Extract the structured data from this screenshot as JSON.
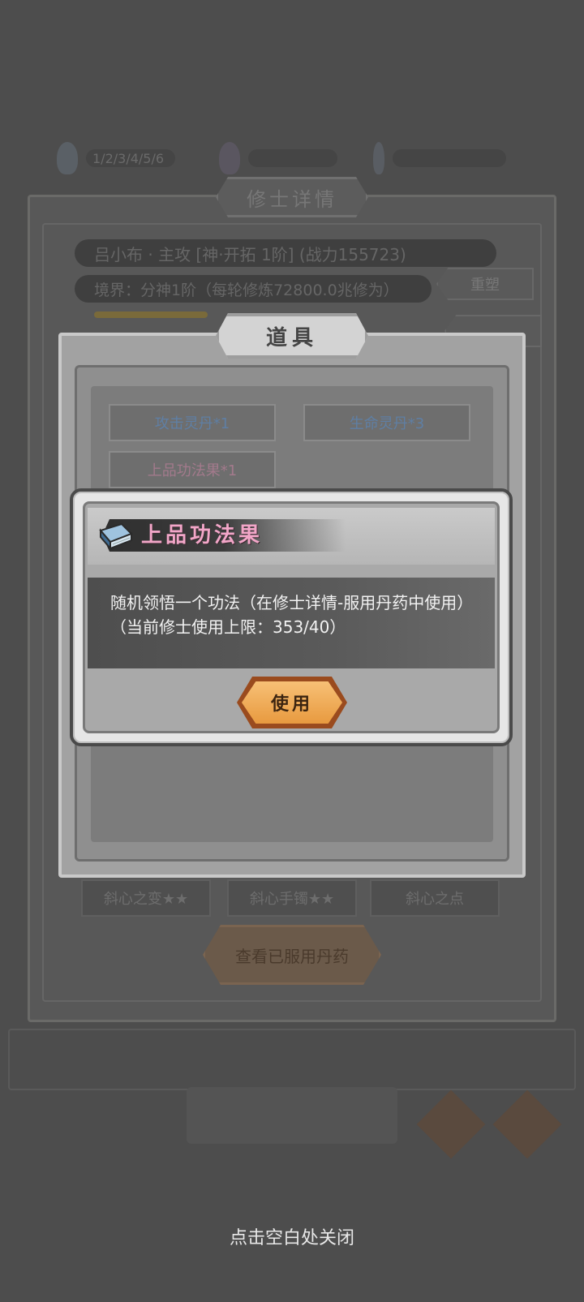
{
  "background": {
    "top_bar": [
      {
        "icon": "blue-orb-icon",
        "text": "1/2/3/4/5/6"
      },
      {
        "icon": "purple-orb-icon",
        "text": ""
      },
      {
        "icon": "feather-icon",
        "text": ""
      }
    ],
    "header_title": "修士详情",
    "name_row": "吕小布 · 主攻 [神·开拓 1阶] (战力155723)",
    "realm_row": "境界：分神1阶（每轮修炼72800.0兆修为）",
    "reset_button": "重塑",
    "side_button_2": "",
    "gem_buttons": [
      "斜心之变★★",
      "斜心手镯★★",
      "斜心之点"
    ],
    "check_button": "查看已服用丹药"
  },
  "items_panel": {
    "title": "道具",
    "items": [
      {
        "label": "攻击灵丹*1"
      },
      {
        "label": "生命灵丹*3"
      },
      {
        "label": "上品功法果*1"
      }
    ]
  },
  "popup": {
    "title": "上品功法果",
    "description": "随机领悟一个功法（在修士详情-服用丹药中使用）（当前修士使用上限：353/40）",
    "use_button": "使用"
  },
  "close_hint": "点击空白处关闭",
  "colors": {
    "popup_title": "#f2a6c8",
    "use_button": "#e89a3f",
    "item_blue": "#5f7fa4",
    "item_pink": "#a37a8c"
  }
}
